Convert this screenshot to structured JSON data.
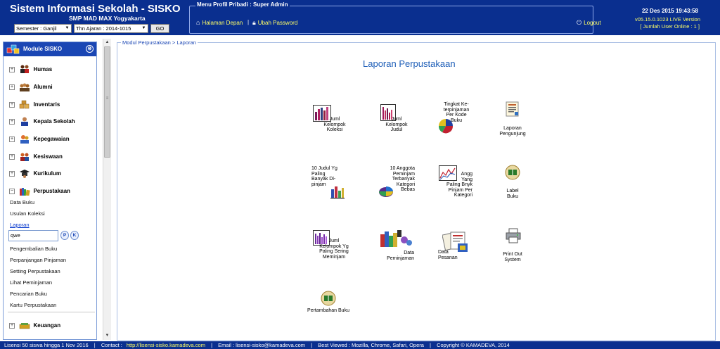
{
  "header": {
    "app_title": "Sistem Informasi Sekolah - SISKO",
    "school_name": "SMP MAD MAX Yogyakarta",
    "semester_select": "Semester : Ganjil",
    "year_select": "Thn Ajaran : 2014-1015",
    "go_label": "GO",
    "profile_legend": "Menu Profil Pribadi : Super Admin",
    "home_link": "Halaman Depan",
    "separator": "|",
    "password_link": "Ubah Password",
    "logout_link": "Logout",
    "datetime": "22 Des 2015 19:43:58",
    "version": "v05.15.0.1023 LIVE Version",
    "users_online": "[ Jumlah User Online : 1 ]"
  },
  "sidebar": {
    "module_title": "Module SISKO",
    "groups": [
      {
        "label": "Humas",
        "toggle": "+"
      },
      {
        "label": "Alumni",
        "toggle": "+"
      },
      {
        "label": "Inventaris",
        "toggle": "+"
      },
      {
        "label": "Kepala Sekolah",
        "toggle": "+"
      },
      {
        "label": "Kepegawaian",
        "toggle": "+"
      },
      {
        "label": "Kesiswaan",
        "toggle": "+"
      },
      {
        "label": "Kurikulum",
        "toggle": "+"
      },
      {
        "label": "Perpustakaan",
        "toggle": "−"
      },
      {
        "label": "Keuangan",
        "toggle": "+"
      }
    ],
    "library_items": [
      "Data Buku",
      "Usulan Koleksi",
      "Laporan"
    ],
    "search_value": "qwe",
    "search_p": "P",
    "search_k": "K",
    "library_items_2": [
      "Pengembalian Buku",
      "Perpanjangan Pinjaman",
      "Setting Perpustakaan",
      "Lihat Peminjaman",
      "Pencarian Buku",
      "Kartu Perpustakaan"
    ]
  },
  "content": {
    "breadcrumb": "Modul Perpustakaan > Laporan",
    "title": "Laporan Perpustakaan",
    "reports": [
      {
        "label": "Juml\nKelompok\nKoleksi"
      },
      {
        "label": "Juml\nKelompok\nJudul"
      },
      {
        "label": "Tingkat Ke-\nterpinjaman\nPer Kode\nBuku"
      },
      {
        "label": "Laporan\nPengunjung"
      },
      {
        "label": "10 Judul Yg\nPaling\nBanyak Di-\npinjam"
      },
      {
        "label": "10 Anggota\nPeminjam\nTerbanyak\nKategori\nBebas"
      },
      {
        "label": "Angg\nYang\nPaling Bnyk\nPinjam Per\nKategori"
      },
      {
        "label": "Label\nBuku"
      },
      {
        "label": "Juml\nKelompok Yg\nPaling Sering\nMeminjam"
      },
      {
        "label": "Data\nPeminjaman"
      },
      {
        "label": "Data\nPesanan"
      },
      {
        "label": "Print Out\nSystem"
      },
      {
        "label": "Pertambahan Buku"
      }
    ]
  },
  "footer": {
    "license": "Lisensi 50 siswa hingga 1 Nov 2016",
    "sep": "|",
    "contact_label": "Contact :",
    "contact_url": "http://lisensi-sisko.kamadeva.com",
    "email": "Email : lisensi-sisko@kamadeva.com",
    "best_viewed": "Best Viewed : Mozilla, Chrome, Safari, Opera",
    "copyright": "Copyright © KAMADEVA, 2014"
  }
}
